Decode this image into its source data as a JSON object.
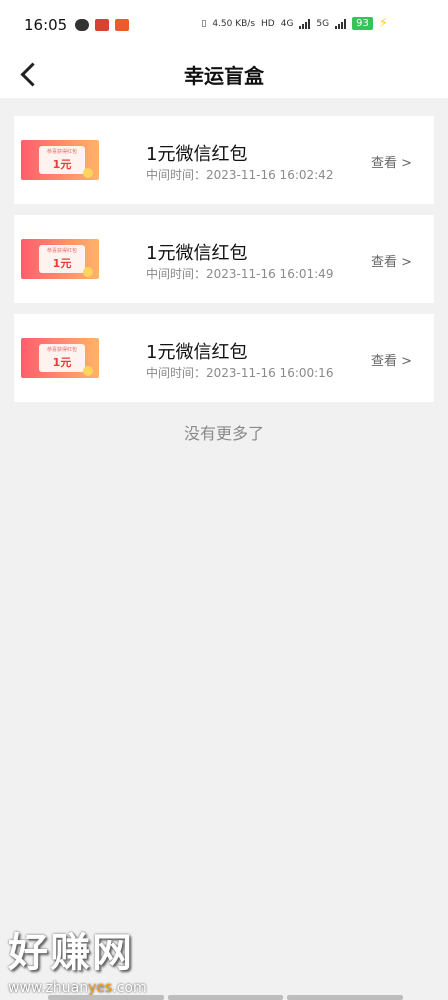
{
  "status_bar": {
    "time": "16:05",
    "speed": "4.50\nKB/s",
    "hd": "HD",
    "net4g": "4G",
    "net5g": "5G",
    "battery": "93"
  },
  "header": {
    "title": "幸运盲盒"
  },
  "items": [
    {
      "thumb_amount": "1元",
      "thumb_caption": "恭喜获得红包",
      "name": "1元微信红包",
      "time": "中间时间：2023-11-16 16:02:42",
      "view_label": "查看 >"
    },
    {
      "thumb_amount": "1元",
      "thumb_caption": "恭喜获得红包",
      "name": "1元微信红包",
      "time": "中间时间：2023-11-16 16:01:49",
      "view_label": "查看 >"
    },
    {
      "thumb_amount": "1元",
      "thumb_caption": "恭喜获得红包",
      "name": "1元微信红包",
      "time": "中间时间：2023-11-16 16:00:16",
      "view_label": "查看 >"
    }
  ],
  "footer": {
    "no_more": "没有更多了"
  },
  "watermark": {
    "big": "好赚网",
    "url_left": "www.zhuan",
    "url_mid": "yes",
    "url_right": ".com"
  },
  "colors": {
    "accent_red": "#e63d3d",
    "battery_green": "#38c25a",
    "watermark_orange": "#f59d1b"
  }
}
